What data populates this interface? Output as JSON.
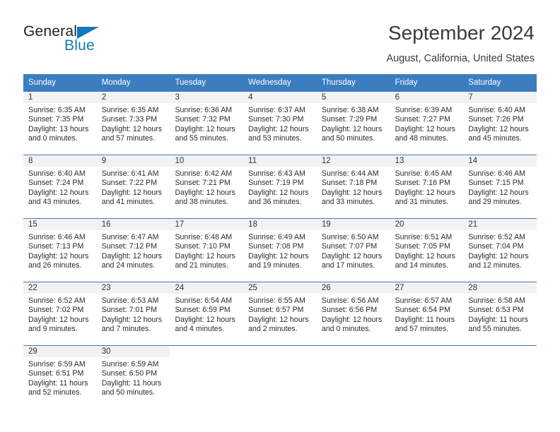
{
  "brand": {
    "word_one": "General",
    "word_two": "Blue",
    "logo_icon": "triangle-icon"
  },
  "header": {
    "title": "September 2024",
    "subtitle": "August, California, United States"
  },
  "colors": {
    "header_blue": "#3c7dbf",
    "brand_blue": "#1277bf",
    "daynum_band": "#f2f2f2",
    "text": "#2b2b2b"
  },
  "labels": {
    "sunrise_prefix": "Sunrise:",
    "sunset_prefix": "Sunset:",
    "daylight_prefix": "Daylight:"
  },
  "weekdays": [
    "Sunday",
    "Monday",
    "Tuesday",
    "Wednesday",
    "Thursday",
    "Friday",
    "Saturday"
  ],
  "weeks": [
    [
      {
        "day": "1",
        "line1": "Sunrise: 6:35 AM",
        "line2": "Sunset: 7:35 PM",
        "line3": "Daylight: 13 hours",
        "line4": "and 0 minutes."
      },
      {
        "day": "2",
        "line1": "Sunrise: 6:35 AM",
        "line2": "Sunset: 7:33 PM",
        "line3": "Daylight: 12 hours",
        "line4": "and 57 minutes."
      },
      {
        "day": "3",
        "line1": "Sunrise: 6:36 AM",
        "line2": "Sunset: 7:32 PM",
        "line3": "Daylight: 12 hours",
        "line4": "and 55 minutes."
      },
      {
        "day": "4",
        "line1": "Sunrise: 6:37 AM",
        "line2": "Sunset: 7:30 PM",
        "line3": "Daylight: 12 hours",
        "line4": "and 53 minutes."
      },
      {
        "day": "5",
        "line1": "Sunrise: 6:38 AM",
        "line2": "Sunset: 7:29 PM",
        "line3": "Daylight: 12 hours",
        "line4": "and 50 minutes."
      },
      {
        "day": "6",
        "line1": "Sunrise: 6:39 AM",
        "line2": "Sunset: 7:27 PM",
        "line3": "Daylight: 12 hours",
        "line4": "and 48 minutes."
      },
      {
        "day": "7",
        "line1": "Sunrise: 6:40 AM",
        "line2": "Sunset: 7:26 PM",
        "line3": "Daylight: 12 hours",
        "line4": "and 45 minutes."
      }
    ],
    [
      {
        "day": "8",
        "line1": "Sunrise: 6:40 AM",
        "line2": "Sunset: 7:24 PM",
        "line3": "Daylight: 12 hours",
        "line4": "and 43 minutes."
      },
      {
        "day": "9",
        "line1": "Sunrise: 6:41 AM",
        "line2": "Sunset: 7:22 PM",
        "line3": "Daylight: 12 hours",
        "line4": "and 41 minutes."
      },
      {
        "day": "10",
        "line1": "Sunrise: 6:42 AM",
        "line2": "Sunset: 7:21 PM",
        "line3": "Daylight: 12 hours",
        "line4": "and 38 minutes."
      },
      {
        "day": "11",
        "line1": "Sunrise: 6:43 AM",
        "line2": "Sunset: 7:19 PM",
        "line3": "Daylight: 12 hours",
        "line4": "and 36 minutes."
      },
      {
        "day": "12",
        "line1": "Sunrise: 6:44 AM",
        "line2": "Sunset: 7:18 PM",
        "line3": "Daylight: 12 hours",
        "line4": "and 33 minutes."
      },
      {
        "day": "13",
        "line1": "Sunrise: 6:45 AM",
        "line2": "Sunset: 7:16 PM",
        "line3": "Daylight: 12 hours",
        "line4": "and 31 minutes."
      },
      {
        "day": "14",
        "line1": "Sunrise: 6:46 AM",
        "line2": "Sunset: 7:15 PM",
        "line3": "Daylight: 12 hours",
        "line4": "and 29 minutes."
      }
    ],
    [
      {
        "day": "15",
        "line1": "Sunrise: 6:46 AM",
        "line2": "Sunset: 7:13 PM",
        "line3": "Daylight: 12 hours",
        "line4": "and 26 minutes."
      },
      {
        "day": "16",
        "line1": "Sunrise: 6:47 AM",
        "line2": "Sunset: 7:12 PM",
        "line3": "Daylight: 12 hours",
        "line4": "and 24 minutes."
      },
      {
        "day": "17",
        "line1": "Sunrise: 6:48 AM",
        "line2": "Sunset: 7:10 PM",
        "line3": "Daylight: 12 hours",
        "line4": "and 21 minutes."
      },
      {
        "day": "18",
        "line1": "Sunrise: 6:49 AM",
        "line2": "Sunset: 7:08 PM",
        "line3": "Daylight: 12 hours",
        "line4": "and 19 minutes."
      },
      {
        "day": "19",
        "line1": "Sunrise: 6:50 AM",
        "line2": "Sunset: 7:07 PM",
        "line3": "Daylight: 12 hours",
        "line4": "and 17 minutes."
      },
      {
        "day": "20",
        "line1": "Sunrise: 6:51 AM",
        "line2": "Sunset: 7:05 PM",
        "line3": "Daylight: 12 hours",
        "line4": "and 14 minutes."
      },
      {
        "day": "21",
        "line1": "Sunrise: 6:52 AM",
        "line2": "Sunset: 7:04 PM",
        "line3": "Daylight: 12 hours",
        "line4": "and 12 minutes."
      }
    ],
    [
      {
        "day": "22",
        "line1": "Sunrise: 6:52 AM",
        "line2": "Sunset: 7:02 PM",
        "line3": "Daylight: 12 hours",
        "line4": "and 9 minutes."
      },
      {
        "day": "23",
        "line1": "Sunrise: 6:53 AM",
        "line2": "Sunset: 7:01 PM",
        "line3": "Daylight: 12 hours",
        "line4": "and 7 minutes."
      },
      {
        "day": "24",
        "line1": "Sunrise: 6:54 AM",
        "line2": "Sunset: 6:59 PM",
        "line3": "Daylight: 12 hours",
        "line4": "and 4 minutes."
      },
      {
        "day": "25",
        "line1": "Sunrise: 6:55 AM",
        "line2": "Sunset: 6:57 PM",
        "line3": "Daylight: 12 hours",
        "line4": "and 2 minutes."
      },
      {
        "day": "26",
        "line1": "Sunrise: 6:56 AM",
        "line2": "Sunset: 6:56 PM",
        "line3": "Daylight: 12 hours",
        "line4": "and 0 minutes."
      },
      {
        "day": "27",
        "line1": "Sunrise: 6:57 AM",
        "line2": "Sunset: 6:54 PM",
        "line3": "Daylight: 11 hours",
        "line4": "and 57 minutes."
      },
      {
        "day": "28",
        "line1": "Sunrise: 6:58 AM",
        "line2": "Sunset: 6:53 PM",
        "line3": "Daylight: 11 hours",
        "line4": "and 55 minutes."
      }
    ],
    [
      {
        "day": "29",
        "line1": "Sunrise: 6:59 AM",
        "line2": "Sunset: 6:51 PM",
        "line3": "Daylight: 11 hours",
        "line4": "and 52 minutes."
      },
      {
        "day": "30",
        "line1": "Sunrise: 6:59 AM",
        "line2": "Sunset: 6:50 PM",
        "line3": "Daylight: 11 hours",
        "line4": "and 50 minutes."
      },
      {
        "day": "",
        "line1": "",
        "line2": "",
        "line3": "",
        "line4": ""
      },
      {
        "day": "",
        "line1": "",
        "line2": "",
        "line3": "",
        "line4": ""
      },
      {
        "day": "",
        "line1": "",
        "line2": "",
        "line3": "",
        "line4": ""
      },
      {
        "day": "",
        "line1": "",
        "line2": "",
        "line3": "",
        "line4": ""
      },
      {
        "day": "",
        "line1": "",
        "line2": "",
        "line3": "",
        "line4": ""
      }
    ]
  ]
}
